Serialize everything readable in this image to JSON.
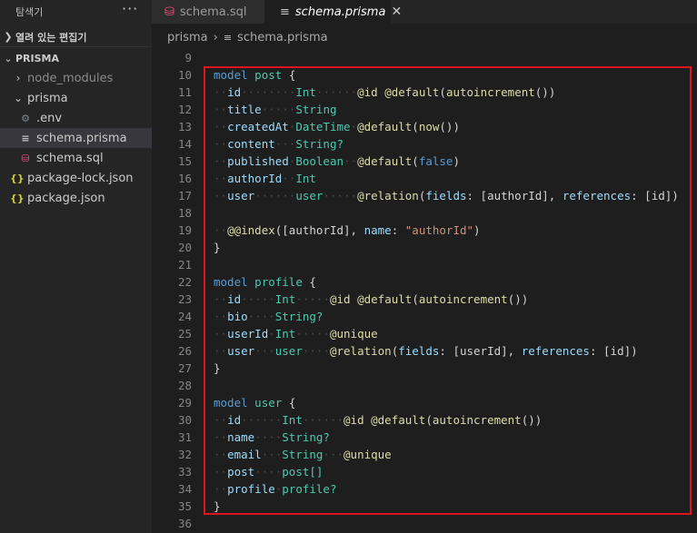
{
  "sidebar": {
    "title": "탐색기",
    "more": "···",
    "open_editors": "열려 있는 편집기",
    "folder": "PRISMA",
    "items": [
      {
        "label": "node_modules",
        "kind": "folder-collapsed"
      },
      {
        "label": "prisma",
        "kind": "folder-open"
      },
      {
        "label": ".env",
        "kind": "env"
      },
      {
        "label": "schema.prisma",
        "kind": "prisma"
      },
      {
        "label": "schema.sql",
        "kind": "sql"
      },
      {
        "label": "package-lock.json",
        "kind": "json"
      },
      {
        "label": "package.json",
        "kind": "json"
      }
    ]
  },
  "tabs": [
    {
      "label": "schema.sql",
      "icon": "database-icon"
    },
    {
      "label": "schema.prisma",
      "icon": "lines-icon",
      "active": true
    }
  ],
  "breadcrumb": [
    "prisma",
    "schema.prisma"
  ],
  "line_numbers": [
    "9",
    "10",
    "11",
    "12",
    "13",
    "14",
    "15",
    "16",
    "17",
    "18",
    "19",
    "20",
    "21",
    "22",
    "23",
    "24",
    "25",
    "26",
    "27",
    "28",
    "29",
    "30",
    "31",
    "32",
    "33",
    "34",
    "35",
    "36"
  ],
  "code_lines": [
    "",
    "model post {",
    "  id        Int      @id @default(autoincrement())",
    "  title     String",
    "  createdAt DateTime @default(now())",
    "  content   String?",
    "  published Boolean  @default(false)",
    "  authorId  Int",
    "  user      user     @relation(fields: [authorId], references: [id])",
    "",
    "  @@index([authorId], name: \"authorId\")",
    "}",
    "",
    "model profile {",
    "  id     Int     @id @default(autoincrement())",
    "  bio    String?",
    "  userId Int     @unique",
    "  user   user    @relation(fields: [userId], references: [id])",
    "}",
    "",
    "model user {",
    "  id      Int      @id @default(autoincrement())",
    "  name    String?",
    "  email   String   @unique",
    "  post    post[]",
    "  profile profile?",
    "}",
    ""
  ],
  "colors": {
    "highlight": "#e0141e",
    "keyword": "#569cd6",
    "type": "#4ec9b0",
    "field": "#9cdcfe",
    "attribute": "#dcdcaa",
    "string": "#ce9178"
  }
}
